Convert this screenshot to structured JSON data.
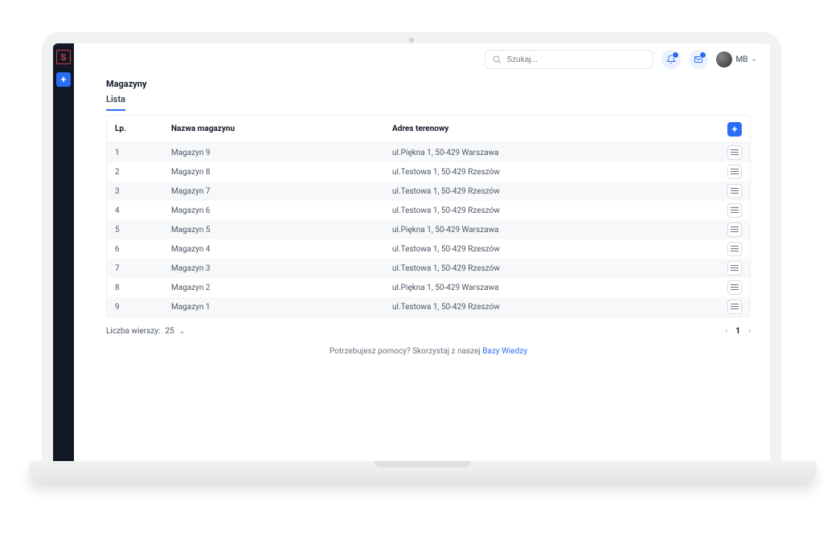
{
  "header": {
    "search_placeholder": "Szukaj...",
    "user_initials": "MB"
  },
  "page": {
    "title": "Magazyny",
    "tab_label": "Lista"
  },
  "table": {
    "columns": {
      "lp": "Lp.",
      "name": "Nazwa magazynu",
      "address": "Adres terenowy"
    },
    "rows": [
      {
        "lp": "1",
        "name": "Magazyn 9",
        "address": "ul.Piękna 1, 50-429 Warszawa"
      },
      {
        "lp": "2",
        "name": "Magazyn 8",
        "address": "ul.Testowa 1, 50-429 Rzeszów"
      },
      {
        "lp": "3",
        "name": "Magazyn 7",
        "address": "ul.Testowa 1, 50-429 Rzeszów"
      },
      {
        "lp": "4",
        "name": "Magazyn 6",
        "address": "ul.Testowa 1, 50-429 Rzeszów"
      },
      {
        "lp": "5",
        "name": "Magazyn 5",
        "address": "ul.Piękna 1, 50-429 Warszawa"
      },
      {
        "lp": "6",
        "name": "Magazyn 4",
        "address": "ul.Testowa 1, 50-429 Rzeszów"
      },
      {
        "lp": "7",
        "name": "Magazyn 3",
        "address": "ul.Testowa 1, 50-429 Rzeszów"
      },
      {
        "lp": "8",
        "name": "Magazyn 2",
        "address": "ul.Piękna 1, 50-429 Warszawa"
      },
      {
        "lp": "9",
        "name": "Magazyn 1",
        "address": "ul.Testowa 1, 50-429 Rzeszów"
      }
    ]
  },
  "footer": {
    "rows_label": "Liczba wierszy:",
    "rows_value": "25",
    "current_page": "1",
    "help_prefix": "Potrzebujesz pomocy? Skorzystaj z naszej ",
    "help_link": "Bazy Wiedzy"
  }
}
